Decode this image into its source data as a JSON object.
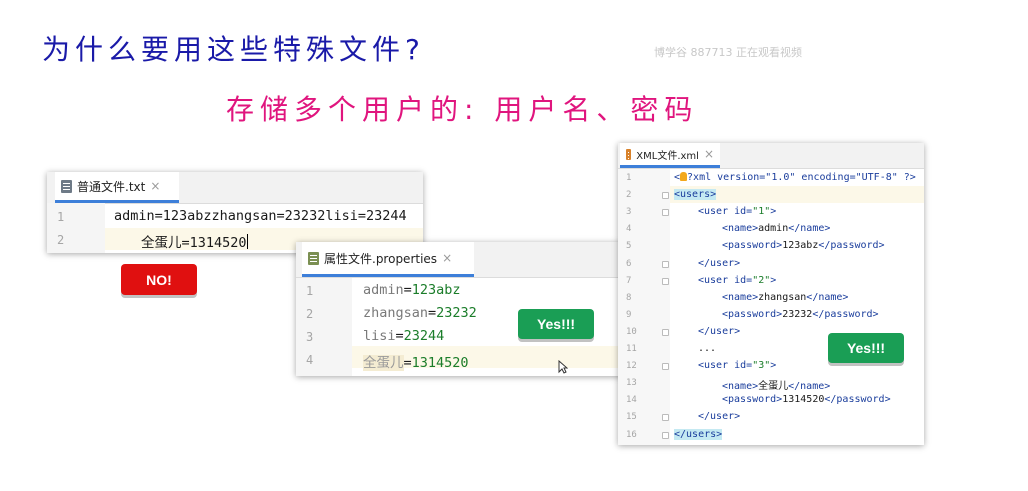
{
  "slide": {
    "title": "为什么要用这些特殊文件?",
    "subtitle": "存储多个用户的: 用户名、密码",
    "watermark": "博学谷 887713 正在观看视频"
  },
  "txt_file": {
    "tab_label": "普通文件.txt",
    "close_icon": "×",
    "lines": [
      {
        "num": "1",
        "text": "admin=123abzzhangsan=23232lisi=23244"
      },
      {
        "num": "2",
        "text": "全蛋儿=1314520"
      }
    ],
    "badge": "NO!"
  },
  "properties_file": {
    "tab_label": "属性文件.properties",
    "close_icon": "×",
    "lines": [
      {
        "num": "1",
        "key": "admin",
        "eq": "=",
        "value": "123abz"
      },
      {
        "num": "2",
        "key": "zhangsan",
        "eq": "=",
        "value": "23232"
      },
      {
        "num": "3",
        "key": "lisi",
        "eq": "=",
        "value": "23244"
      },
      {
        "num": "4",
        "key": "全蛋儿",
        "eq": "=",
        "value": "1314520"
      }
    ],
    "badge": "Yes!!!"
  },
  "xml_file": {
    "tab_label": "XML文件.xml",
    "close_icon": "×",
    "lines": [
      {
        "num": "1",
        "text": "<?xml version=\"1.0\" encoding=\"UTF-8\" ?>"
      },
      {
        "num": "2",
        "text": "<users>"
      },
      {
        "num": "3",
        "text": "<user id=\"1\">"
      },
      {
        "num": "4",
        "text": "<name>admin</name>"
      },
      {
        "num": "5",
        "text": "<password>123abz</password>"
      },
      {
        "num": "6",
        "text": "</user>"
      },
      {
        "num": "7",
        "text": "<user id=\"2\">"
      },
      {
        "num": "8",
        "text": "<name>zhangsan</name>"
      },
      {
        "num": "9",
        "text": "<password>23232</password>"
      },
      {
        "num": "10",
        "text": "</user>"
      },
      {
        "num": "11",
        "text": "..."
      },
      {
        "num": "12",
        "text": "<user id=\"3\">"
      },
      {
        "num": "13",
        "text": "<name>全蛋儿</name>"
      },
      {
        "num": "14",
        "text": "<password>1314520</password>"
      },
      {
        "num": "15",
        "text": "</user>"
      },
      {
        "num": "16",
        "text": "</users>"
      }
    ],
    "badge": "Yes!!!"
  },
  "colors": {
    "title": "#1a1aa8",
    "subtitle": "#e0157e",
    "no_badge": "#e01010",
    "yes_badge": "#1a9e55",
    "tab_underline": "#3d7fd9",
    "prop_value": "#1b7d2a",
    "xml_tag": "#1a3d9c"
  },
  "icons": [
    "file-icon",
    "properties-file-icon",
    "xml-file-icon",
    "close-icon",
    "intention-bulb-icon",
    "fold-marker-icon",
    "mouse-pointer-icon"
  ]
}
